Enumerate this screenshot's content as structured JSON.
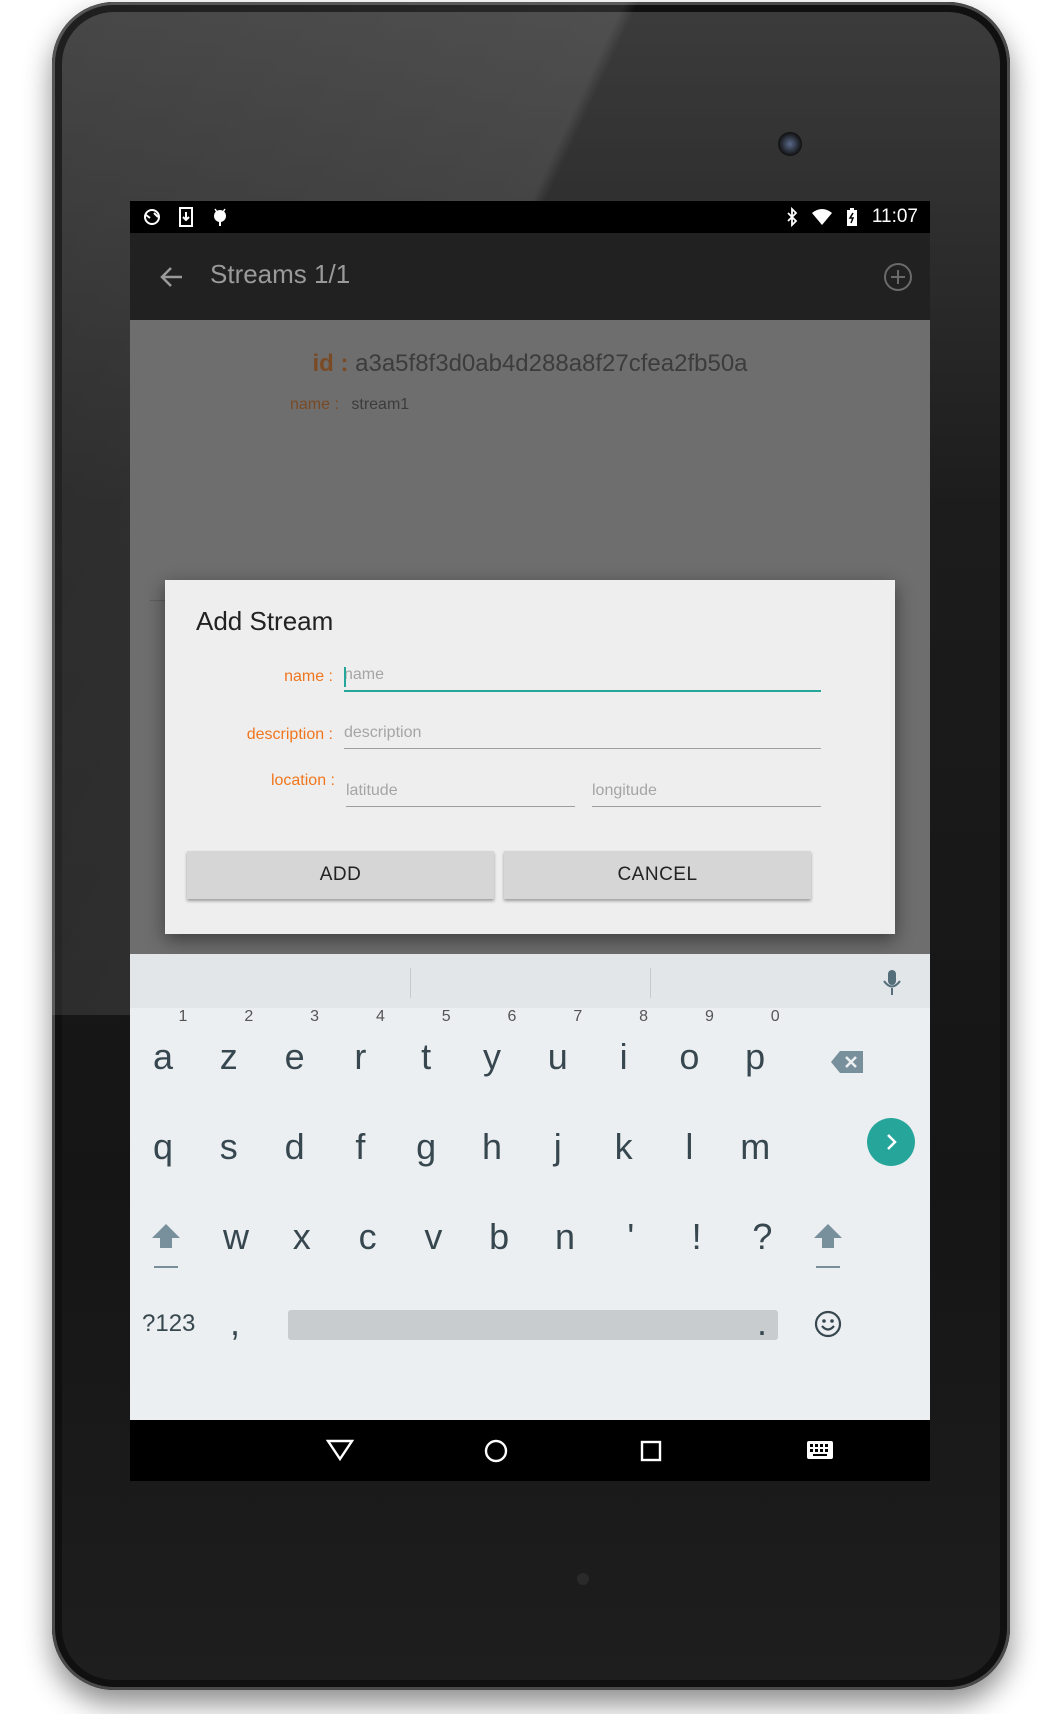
{
  "status_bar": {
    "time": "11:07",
    "left_icons": [
      "sync-icon",
      "download-icon",
      "android-icon"
    ],
    "right_icons": [
      "bluetooth-icon",
      "wifi-icon",
      "battery-charging-icon"
    ]
  },
  "toolbar": {
    "title": "Streams 1/1",
    "back_icon": "arrow-back-icon",
    "add_icon": "add-circle-icon"
  },
  "stream": {
    "id_label": "id :",
    "id_value": "a3a5f8f3d0ab4d288a8f27cfea2fb50a",
    "name_label": "name :",
    "name_value": "stream1"
  },
  "dialog": {
    "title": "Add Stream",
    "name_label": "name :",
    "name_placeholder": "name",
    "name_value": "",
    "description_label": "description :",
    "description_placeholder": "description",
    "description_value": "",
    "location_label": "location :",
    "latitude_placeholder": "latitude",
    "longitude_placeholder": "longitude",
    "add_label": "ADD",
    "cancel_label": "CANCEL"
  },
  "keyboard": {
    "row1": [
      {
        "key": "a",
        "hint": "1"
      },
      {
        "key": "z",
        "hint": "2"
      },
      {
        "key": "e",
        "hint": "3"
      },
      {
        "key": "r",
        "hint": "4"
      },
      {
        "key": "t",
        "hint": "5"
      },
      {
        "key": "y",
        "hint": "6"
      },
      {
        "key": "u",
        "hint": "7"
      },
      {
        "key": "i",
        "hint": "8"
      },
      {
        "key": "o",
        "hint": "9"
      },
      {
        "key": "p",
        "hint": "0"
      }
    ],
    "row2": [
      "q",
      "s",
      "d",
      "f",
      "g",
      "h",
      "j",
      "k",
      "l",
      "m"
    ],
    "row3": [
      "w",
      "x",
      "c",
      "v",
      "b",
      "n",
      "'",
      "!",
      "?"
    ],
    "symbols_label": "?123",
    "comma": ",",
    "period": "."
  },
  "colors": {
    "accent": "#26a69a",
    "label_orange": "#f0761e"
  },
  "nav_bar": [
    "back-triangle-icon",
    "home-circle-icon",
    "recents-square-icon",
    "keyboard-icon"
  ]
}
